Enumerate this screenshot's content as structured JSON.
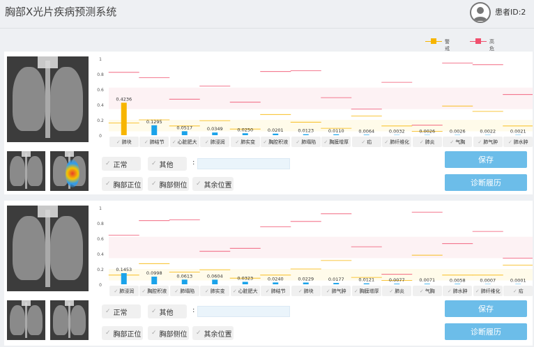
{
  "app": {
    "title": "胸部X光片疾病预测系统",
    "patient_label": "患者ID:2"
  },
  "legend": {
    "warning": "警戒线",
    "danger": "高危线",
    "warning_color": "#f7b500",
    "danger_color": "#f0506e"
  },
  "colors": {
    "bar": "#1aa3ea",
    "bar_highlight": "#f7b500",
    "button": "#6cbde9"
  },
  "panels": [
    {
      "chips": {
        "normal": "正常",
        "other": "其他",
        "colon": ":",
        "frontal": "胸部正位",
        "lateral": "胸部侧位",
        "other_pos": "其余位置"
      },
      "buttons": {
        "save": "保存",
        "history": "诊断履历"
      },
      "chart_data": {
        "type": "bar",
        "ylim": [
          0,
          1
        ],
        "yticks": [
          "1",
          "0.8",
          "0.6",
          "0.4",
          "0.2",
          "0"
        ],
        "categories": [
          "肺块",
          "肺结节",
          "心脏肥大",
          "肺浸润",
          "肺实变",
          "胸腔积液",
          "肺塌陷",
          "胸膜增厚",
          "疝",
          "肺纤维化",
          "肺炎",
          "气胸",
          "肺气肿",
          "肺水肿"
        ],
        "labels": [
          "0.4236",
          "0.1295",
          "0.0517",
          "0.0349",
          "0.0250",
          "0.0201",
          "0.0123",
          "0.0110",
          "0.0064",
          "0.0032",
          "0.0026",
          "0.0026",
          "0.0022",
          "0.0021"
        ],
        "values": [
          0.4236,
          0.1295,
          0.0517,
          0.0349,
          0.025,
          0.0201,
          0.0123,
          0.011,
          0.0064,
          0.0032,
          0.0026,
          0.0026,
          0.0022,
          0.0021
        ],
        "warning": [
          0.16,
          0.2,
          0.12,
          0.19,
          0.08,
          0.27,
          0.17,
          0.09,
          0.25,
          0.12,
          0.05,
          0.38,
          0.31,
          0.12
        ],
        "danger": [
          0.82,
          0.75,
          0.47,
          0.64,
          0.43,
          0.83,
          0.84,
          0.49,
          0.34,
          0.69,
          0.13,
          0.94,
          0.92,
          0.53
        ]
      }
    },
    {
      "chips": {
        "normal": "正常",
        "other": "其他",
        "colon": ":",
        "frontal": "胸部正位",
        "lateral": "胸部侧位",
        "other_pos": "其余位置"
      },
      "buttons": {
        "save": "保存",
        "history": "诊断履历"
      },
      "chart_data": {
        "type": "bar",
        "ylim": [
          0,
          1
        ],
        "yticks": [
          "1",
          "0.8",
          "0.6",
          "0.4",
          "0.2",
          "0"
        ],
        "categories": [
          "肺浸润",
          "胸腔积液",
          "肺塌陷",
          "肺实变",
          "心脏肥大",
          "肺结节",
          "肺块",
          "肺气肿",
          "胸膜增厚",
          "肺炎",
          "气胸",
          "肺水肿",
          "肺纤维化",
          "疝"
        ],
        "labels": [
          "0.1453",
          "0.0998",
          "0.0613",
          "0.0604",
          "0.0323",
          "0.0240",
          "0.0229",
          "0.0177",
          "0.0121",
          "0.0077",
          "0.0071",
          "0.0058",
          "0.0007",
          "0.0001"
        ],
        "values": [
          0.1453,
          0.0998,
          0.0613,
          0.0604,
          0.0323,
          0.024,
          0.0229,
          0.0177,
          0.0121,
          0.0077,
          0.0071,
          0.0058,
          0.0007,
          0.0001
        ],
        "warning": [
          0.12,
          0.27,
          0.16,
          0.19,
          0.08,
          0.12,
          0.2,
          0.31,
          0.09,
          0.05,
          0.38,
          0.12,
          0.12,
          0.25
        ],
        "danger": [
          0.64,
          0.83,
          0.84,
          0.43,
          0.47,
          0.75,
          0.82,
          0.92,
          0.49,
          0.13,
          0.94,
          0.53,
          0.69,
          0.34
        ]
      }
    }
  ]
}
